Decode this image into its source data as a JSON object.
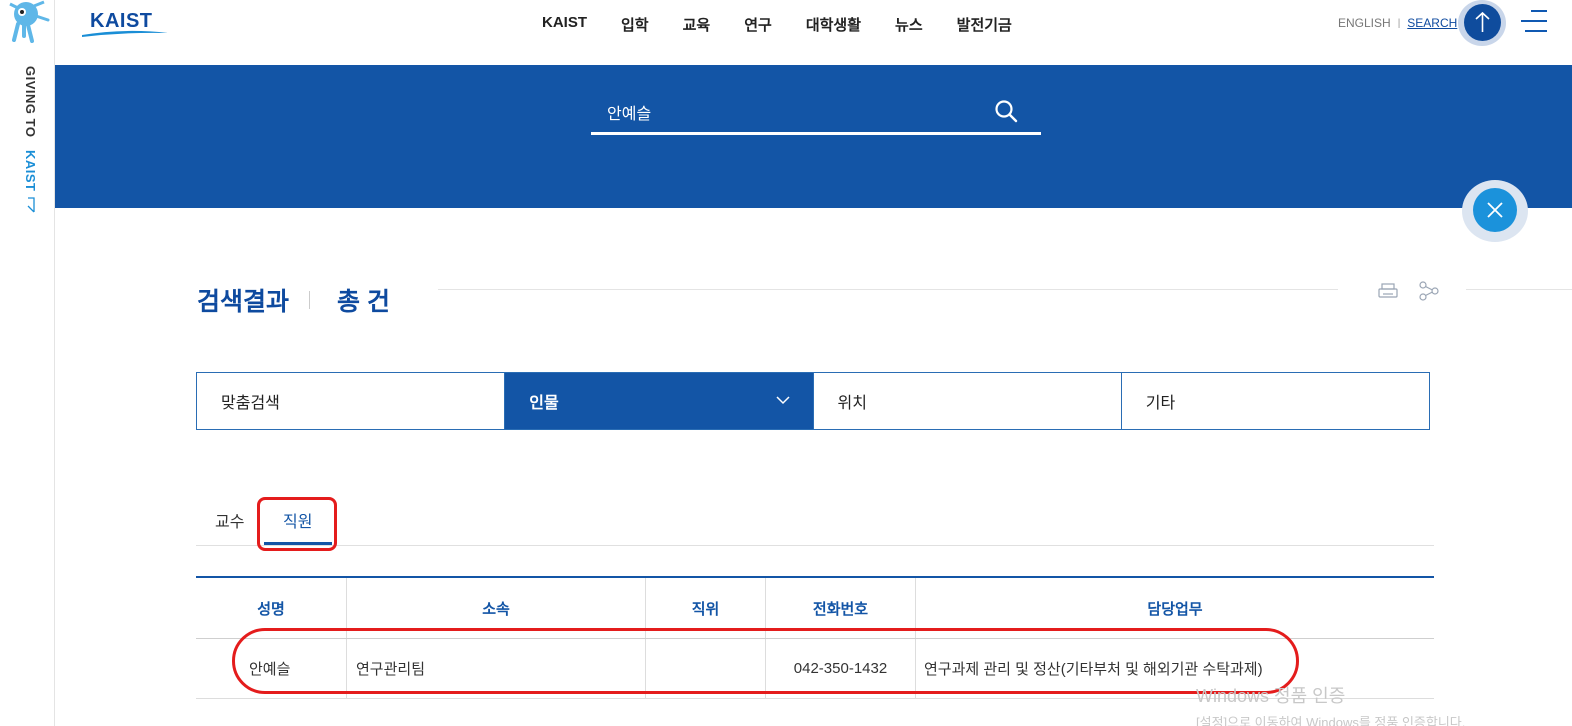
{
  "left_rail": {
    "giving_text": "GIVING TO",
    "giving_kaist": "KAIST"
  },
  "header": {
    "logo_text": "KAIST",
    "nav": [
      "KAIST",
      "입학",
      "교육",
      "연구",
      "대학생활",
      "뉴스",
      "발전기금"
    ],
    "english_label": "ENGLISH",
    "search_label": "SEARCH"
  },
  "search": {
    "query": "안예슬"
  },
  "results": {
    "title": "검색결과",
    "count_label": "총 건"
  },
  "category_tabs": [
    {
      "label": "맞춤검색",
      "active": false
    },
    {
      "label": "인물",
      "active": true
    },
    {
      "label": "위치",
      "active": false
    },
    {
      "label": "기타",
      "active": false
    }
  ],
  "sub_tabs": {
    "professor": "교수",
    "staff": "직원",
    "active": "직원"
  },
  "table": {
    "headers": [
      "성명",
      "소속",
      "직위",
      "전화번호",
      "담당업무"
    ],
    "rows": [
      [
        "안예슬",
        "연구관리팀",
        "",
        "042-350-1432",
        "연구과제 관리 및 정산(기타부처 및 해외기관 수탁과제)"
      ]
    ]
  },
  "watermark": {
    "line1": "Windows 정품 인증",
    "line2": "[설정]으로 이동하여 Windows를 정품 인증합니다."
  },
  "colors": {
    "brand_blue": "#1355a6",
    "accent_cyan": "#1b92db",
    "highlight_red": "#e41c1c"
  }
}
